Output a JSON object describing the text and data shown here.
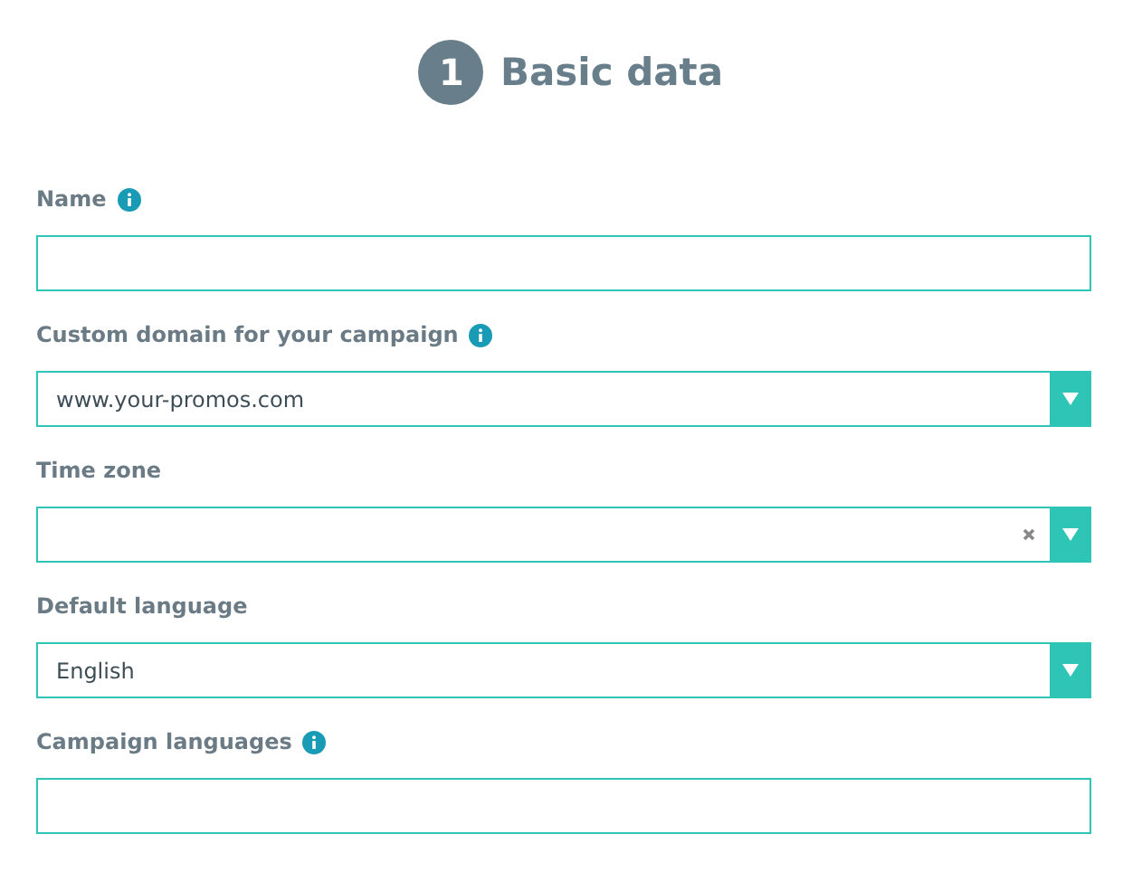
{
  "heading": {
    "step": "1",
    "title": "Basic data"
  },
  "fields": [
    {
      "kind": "text",
      "label": "Name",
      "info": true
    },
    {
      "kind": "select",
      "label": "Custom domain for your campaign",
      "info": true,
      "value": "www.your-promos.com"
    },
    {
      "kind": "select",
      "label": "Time zone",
      "clearable": true
    },
    {
      "kind": "select",
      "label": "Default language",
      "value": "English"
    },
    {
      "kind": "text",
      "label": "Campaign languages",
      "info": true
    }
  ]
}
